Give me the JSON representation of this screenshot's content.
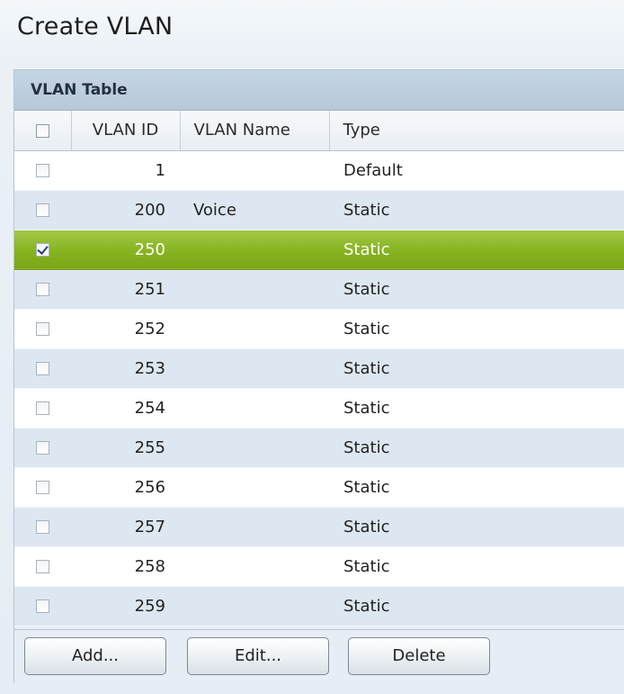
{
  "page": {
    "title": "Create VLAN"
  },
  "table": {
    "title": "VLAN Table",
    "columns": {
      "vlan_id": "VLAN ID",
      "vlan_name": "VLAN Name",
      "type": "Type"
    },
    "rows": [
      {
        "vlan_id": "1",
        "vlan_name": "",
        "type": "Default",
        "checked": false
      },
      {
        "vlan_id": "200",
        "vlan_name": "Voice",
        "type": "Static",
        "checked": false
      },
      {
        "vlan_id": "250",
        "vlan_name": "",
        "type": "Static",
        "checked": true
      },
      {
        "vlan_id": "251",
        "vlan_name": "",
        "type": "Static",
        "checked": false
      },
      {
        "vlan_id": "252",
        "vlan_name": "",
        "type": "Static",
        "checked": false
      },
      {
        "vlan_id": "253",
        "vlan_name": "",
        "type": "Static",
        "checked": false
      },
      {
        "vlan_id": "254",
        "vlan_name": "",
        "type": "Static",
        "checked": false
      },
      {
        "vlan_id": "255",
        "vlan_name": "",
        "type": "Static",
        "checked": false
      },
      {
        "vlan_id": "256",
        "vlan_name": "",
        "type": "Static",
        "checked": false
      },
      {
        "vlan_id": "257",
        "vlan_name": "",
        "type": "Static",
        "checked": false
      },
      {
        "vlan_id": "258",
        "vlan_name": "",
        "type": "Static",
        "checked": false
      },
      {
        "vlan_id": "259",
        "vlan_name": "",
        "type": "Static",
        "checked": false
      }
    ],
    "selected_row_color": "#87b320"
  },
  "buttons": {
    "add": "Add...",
    "edit": "Edit...",
    "delete": "Delete"
  }
}
